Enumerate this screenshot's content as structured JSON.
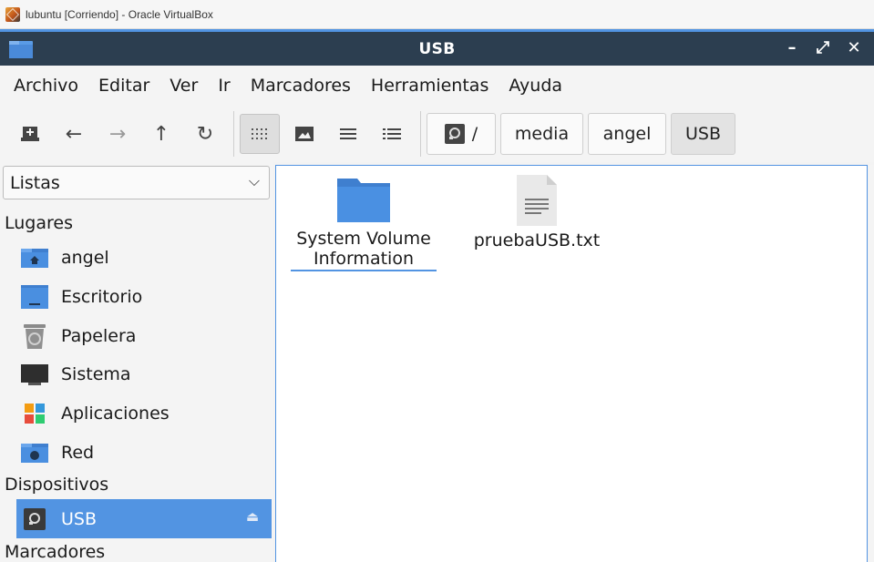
{
  "vbox": {
    "title": "lubuntu [Corriendo] - Oracle VirtualBox"
  },
  "window": {
    "title": "USB",
    "minimize": "–",
    "maximize": "⤢",
    "close": "✕"
  },
  "menu": [
    "Archivo",
    "Editar",
    "Ver",
    "Ir",
    "Marcadores",
    "Herramientas",
    "Ayuda"
  ],
  "path": {
    "root": "/",
    "segments": [
      "media",
      "angel",
      "USB"
    ]
  },
  "sidebar": {
    "view_mode": "Listas",
    "sections": {
      "places": "Lugares",
      "devices": "Dispositivos",
      "bookmarks": "Marcadores"
    },
    "places": [
      "angel",
      "Escritorio",
      "Papelera",
      "Sistema",
      "Aplicaciones",
      "Red"
    ],
    "devices": [
      "USB"
    ]
  },
  "files": [
    {
      "name": "System Volume Information",
      "line1": "System Volume",
      "line2": "Information",
      "type": "folder"
    },
    {
      "name": "pruebaUSB.txt",
      "type": "text-file"
    }
  ],
  "colors": {
    "accent": "#5294e2",
    "titlebar": "#2c3e50",
    "folder": "#4a90e2"
  }
}
